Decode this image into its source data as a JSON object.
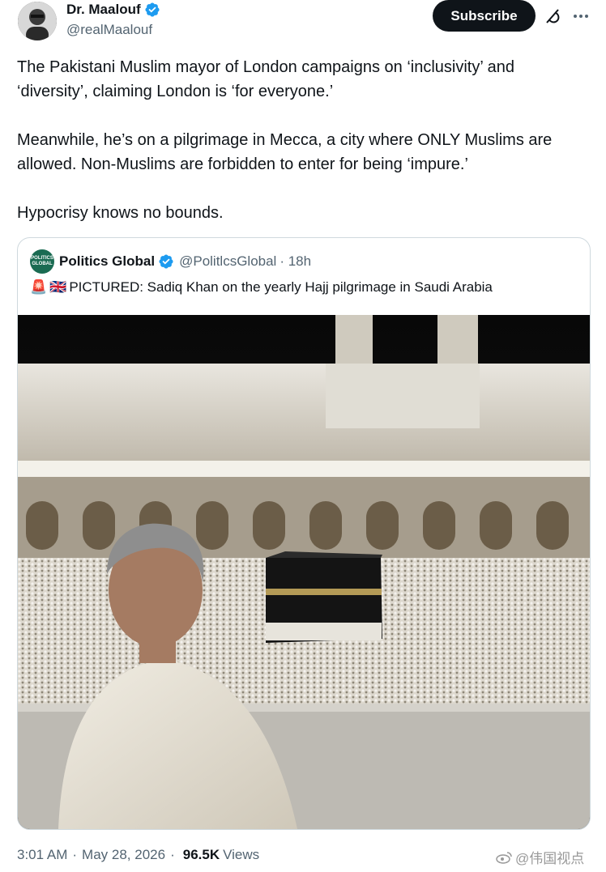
{
  "author": {
    "display_name": "Dr. Maalouf",
    "handle": "@realMaalouf",
    "subscribe_label": "Subscribe"
  },
  "tweet": {
    "paragraphs": [
      "The Pakistani Muslim mayor of London campaigns on ‘inclusivity’ and ‘diversity’, claiming London is ‘for everyone.’",
      "Meanwhile, he’s on a pilgrimage in Mecca, a city where ONLY Muslims are allowed. Non-Muslims are forbidden to enter for being ‘impure.’",
      "Hypocrisy knows no bounds."
    ]
  },
  "quoted": {
    "display_name": "Politics Global",
    "handle": "@PolitlcsGlobal",
    "time": "· 18h",
    "avatar_text": "POLITICS GLOBAL",
    "text": "PICTURED: Sadiq Khan on the yearly Hajj pilgrimage in Saudi Arabia",
    "flags": [
      "🚨",
      "🇬🇧"
    ]
  },
  "meta": {
    "time": "3:01 AM",
    "date": "May 28, 2026",
    "views_count": "96.5K",
    "views_label": "Views"
  },
  "watermark": {
    "text": "@伟国视点"
  },
  "colors": {
    "verified": "#1d9bf0",
    "text_secondary": "#536471",
    "border": "#cfd9de"
  }
}
